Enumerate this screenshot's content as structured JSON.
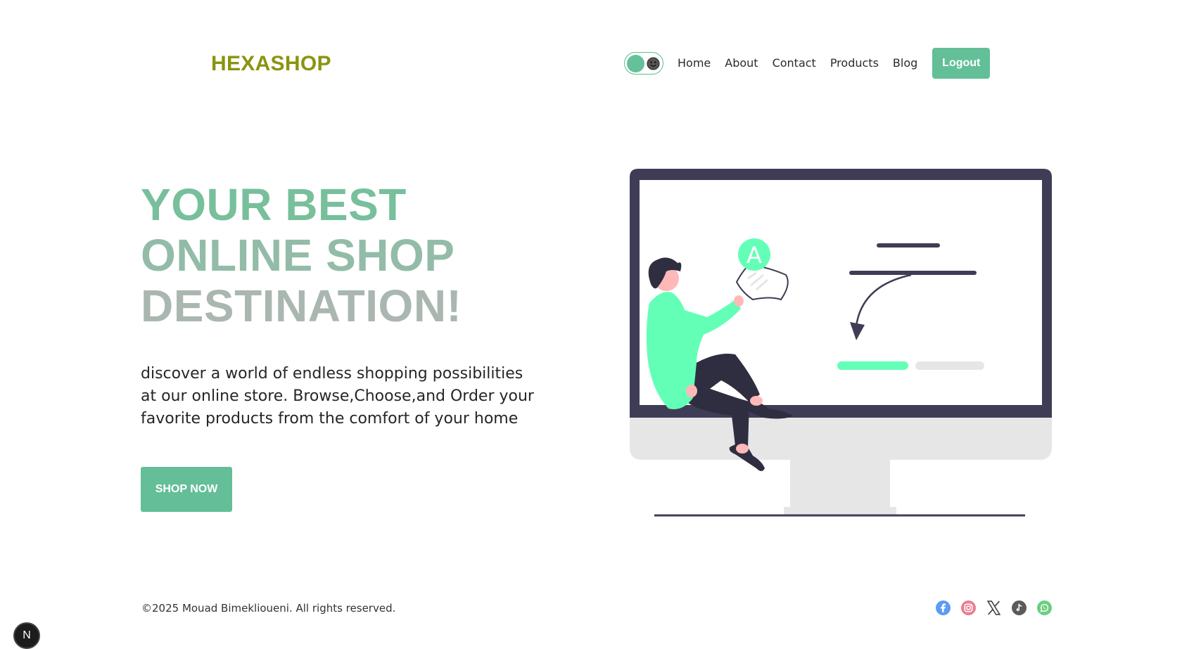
{
  "header": {
    "logo": "HEXASHOP",
    "nav": [
      "Home",
      "About",
      "Contact",
      "Products",
      "Blog"
    ],
    "logout_label": "Logout",
    "theme_toggle": {
      "state": "light",
      "icon": "face-icon"
    }
  },
  "hero": {
    "headline": [
      "YOUR BEST",
      "ONLINE SHOP",
      "DESTINATION!"
    ],
    "description": "discover a world of endless shopping possibilities at our online store. Browse,Choose,and Order your favorite products from the comfort of your home",
    "cta_label": "SHOP NOW",
    "illustration": {
      "badge_letter": "A"
    }
  },
  "footer": {
    "copyright": "©2025 Mouad Bimeklioueni. All rights reserved.",
    "socials": [
      "facebook-icon",
      "instagram-icon",
      "x-icon",
      "tiktok-icon",
      "whatsapp-icon"
    ]
  },
  "devtools_badge": "N",
  "colors": {
    "accent": "#63bf98",
    "logo": "#8a9410",
    "monitor_frame": "#3f3d56",
    "figure_shirt": "#64ffb7"
  }
}
